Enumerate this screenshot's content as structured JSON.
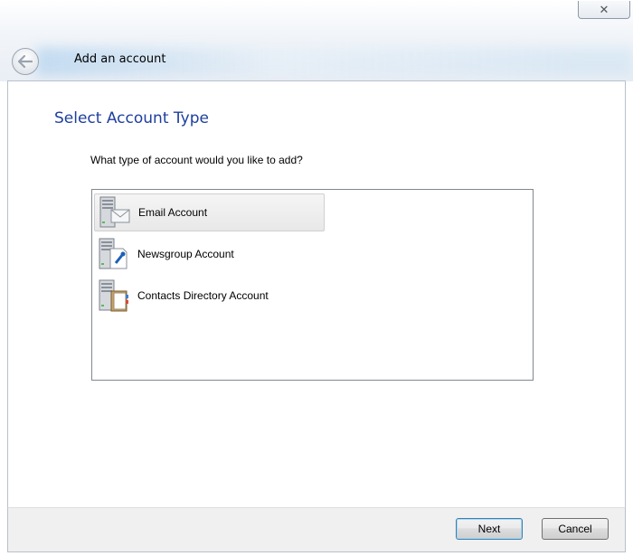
{
  "window": {
    "title": "Add an account",
    "close_glyph": "✕"
  },
  "page": {
    "heading": "Select Account Type",
    "question": "What type of account would you like to add?"
  },
  "account_types": [
    {
      "label": "Email Account",
      "icon": "email-account-icon",
      "selected": true
    },
    {
      "label": "Newsgroup Account",
      "icon": "newsgroup-account-icon",
      "selected": false
    },
    {
      "label": "Contacts Directory Account",
      "icon": "contacts-directory-account-icon",
      "selected": false
    }
  ],
  "buttons": {
    "next": "Next",
    "cancel": "Cancel"
  },
  "colors": {
    "heading": "#1e3f9e",
    "default_button_border": "#3c7fb1"
  }
}
